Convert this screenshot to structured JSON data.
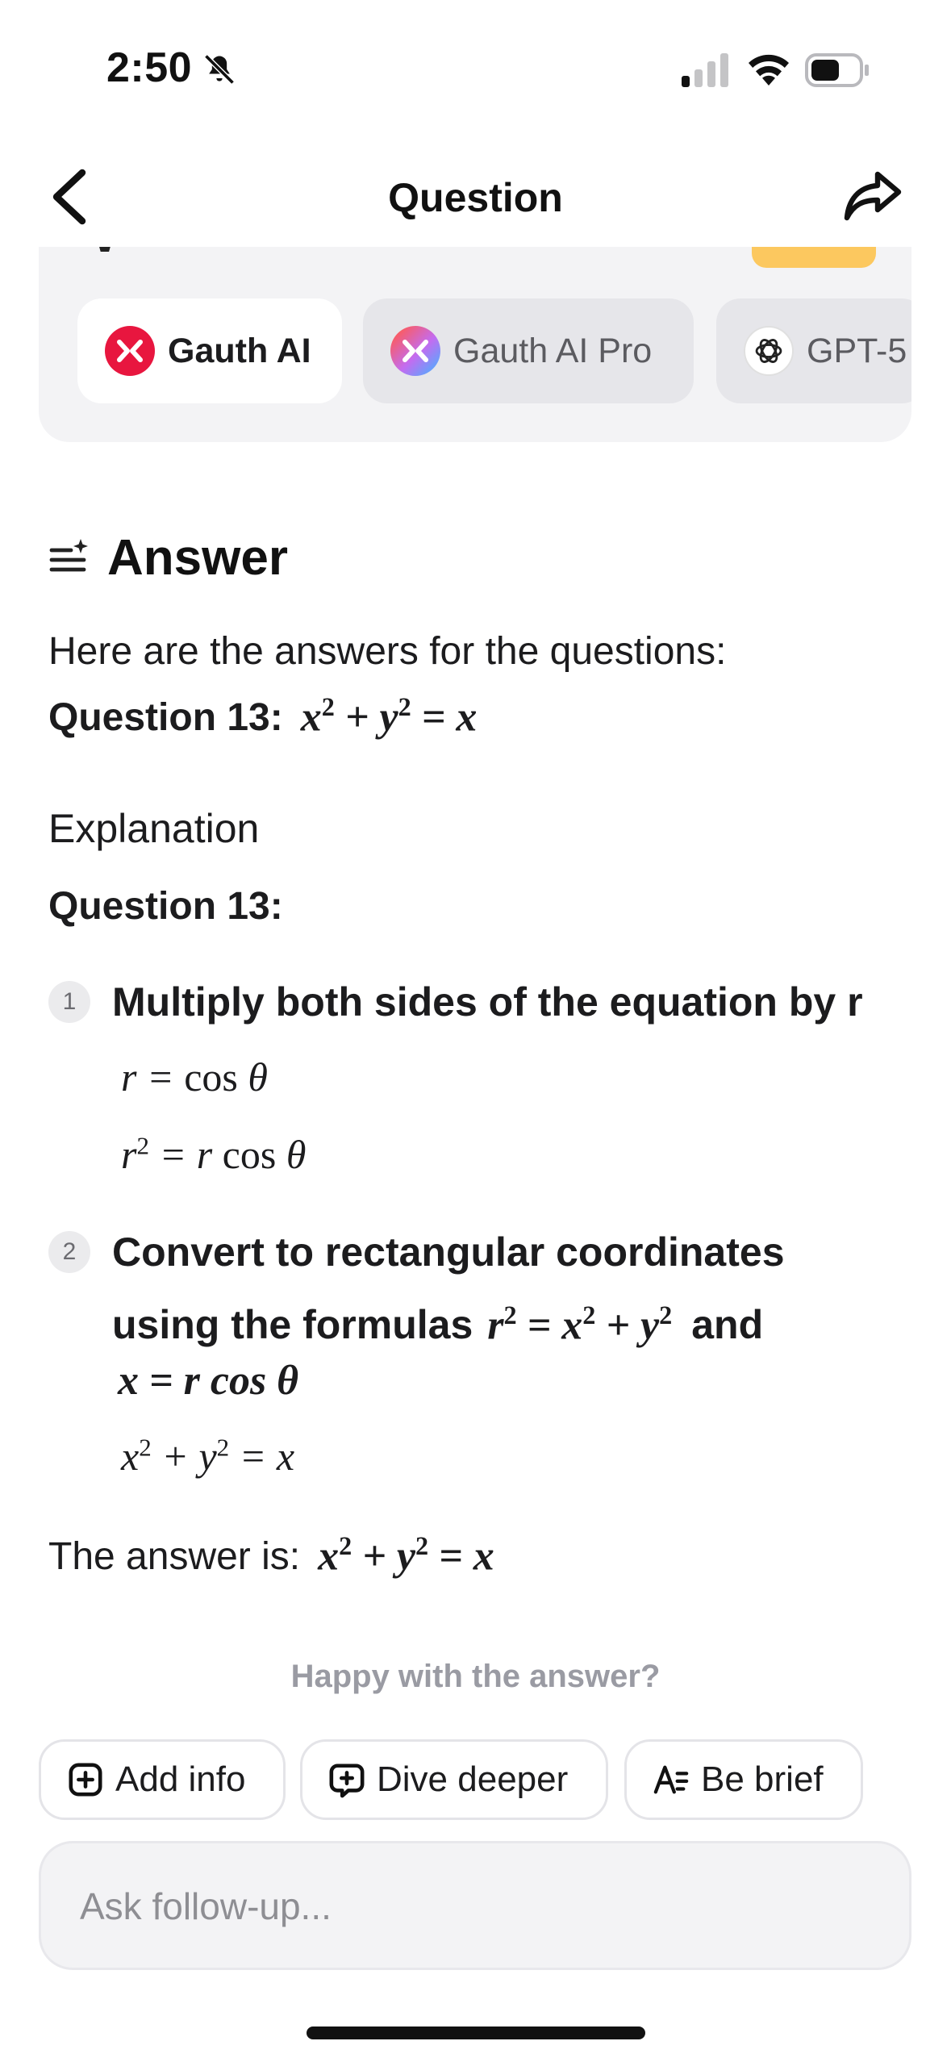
{
  "status_bar": {
    "time": "2:50"
  },
  "nav": {
    "title": "Question"
  },
  "assistant_panel": {
    "chips": [
      {
        "label": "Gauth AI"
      },
      {
        "label": "Gauth AI Pro"
      },
      {
        "label": "GPT-5"
      }
    ]
  },
  "answer": {
    "heading": "Answer",
    "intro": "Here are the answers for the questions:",
    "q_label": "Question 13:",
    "explanation_label": "Explanation",
    "question_heading": "Question 13:",
    "steps": [
      {
        "num": "1",
        "title": "Multiply both sides of the equation by r"
      },
      {
        "num": "2",
        "title_pre": "Convert to rectangular coordinates",
        "title_line2": "using the formulas",
        "title_and": "and"
      }
    ],
    "final_label": "The answer is:"
  },
  "feedback": {
    "prompt": "Happy with the answer?",
    "actions": [
      {
        "label": "Add info"
      },
      {
        "label": "Dive deeper"
      },
      {
        "label": "Be brief"
      }
    ]
  },
  "follow_up": {
    "placeholder": "Ask follow-up..."
  }
}
